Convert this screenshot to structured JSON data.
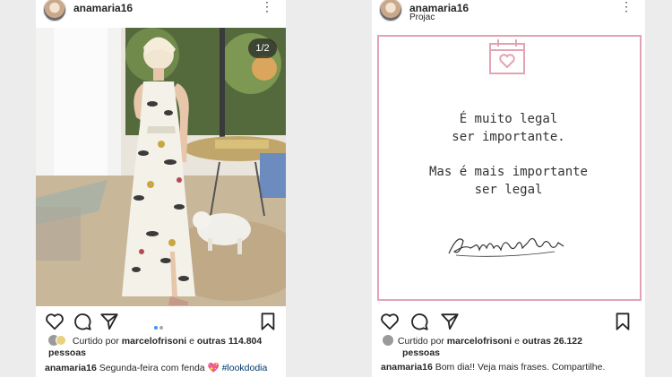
{
  "posts": [
    {
      "username": "anamaria16",
      "location": "",
      "image_counter": "1/2",
      "liked_by_prefix": "Curtido por",
      "liked_by_user": "marcelofrisoni",
      "liked_by_mid": "e",
      "liked_by_others": "outras 114.804",
      "liked_by_suffix": "pessoas",
      "caption_user": "anamaria16",
      "caption_text": "Segunda-feira com fenda",
      "caption_emoji": "💖",
      "caption_tag": "#lookdodia"
    },
    {
      "username": "anamaria16",
      "location": "Projac",
      "quote_lines_1": [
        "É muito legal",
        "ser importante."
      ],
      "quote_lines_2": [
        "Mas é mais importante",
        "ser legal"
      ],
      "signature": "Ana Maria Braga",
      "liked_by_prefix": "Curtido por",
      "liked_by_user": "marcelofrisoni",
      "liked_by_mid": "e",
      "liked_by_others": "outras 26.122",
      "liked_by_suffix": "pessoas",
      "caption_user": "anamaria16",
      "caption_text": "Bom dia!! Veja mais frases. Compartilhe."
    }
  ],
  "icons": [
    "like-icon",
    "comment-icon",
    "share-icon",
    "save-icon",
    "more-options-icon",
    "calendar-heart-icon"
  ],
  "colors": {
    "frame_pink": "#e2a4b2",
    "tag_blue": "#00376b",
    "carousel_dot_active": "#3897f0"
  }
}
